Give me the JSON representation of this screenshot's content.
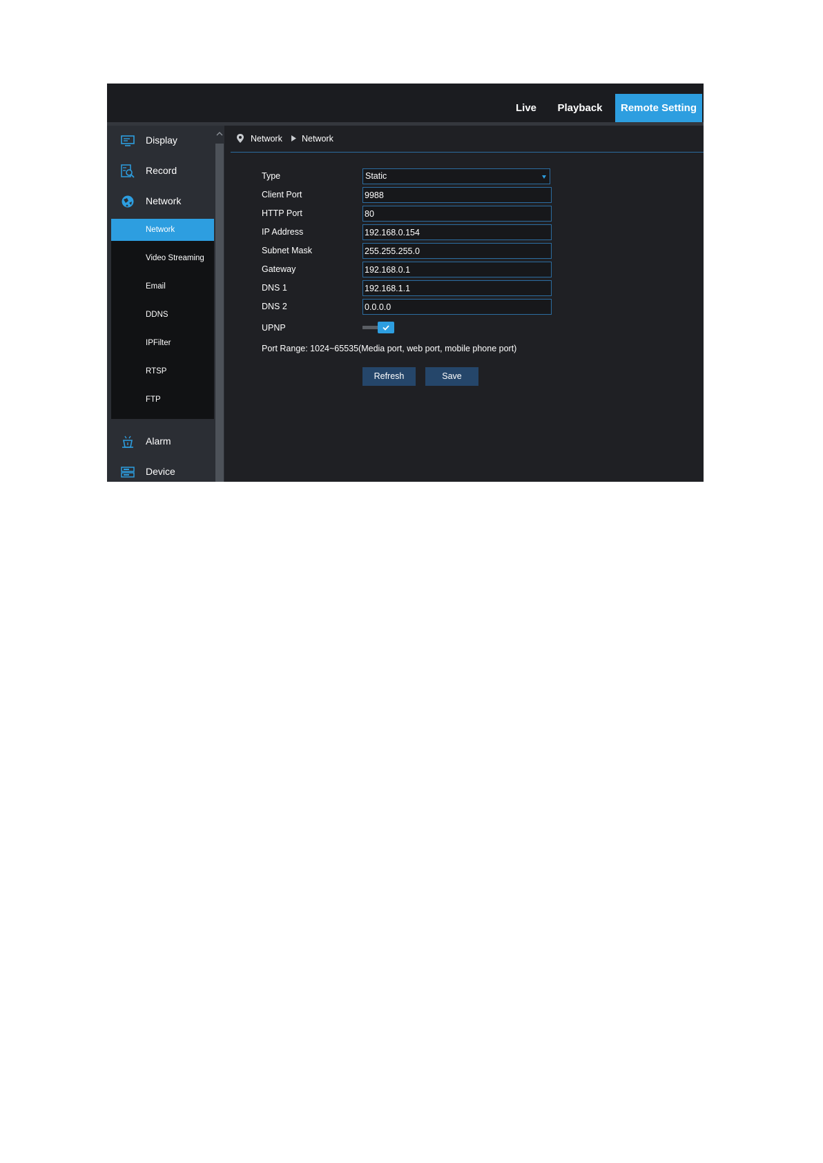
{
  "topbar": {
    "tabs": [
      "Live",
      "Playback",
      "Remote Setting"
    ],
    "active_tab": "Remote Setting"
  },
  "sidebar": {
    "items": [
      {
        "label": "Display",
        "icon": "monitor-icon"
      },
      {
        "label": "Record",
        "icon": "record-search-icon"
      },
      {
        "label": "Network",
        "icon": "network-globe-icon"
      },
      {
        "label": "Alarm",
        "icon": "alarm-icon"
      },
      {
        "label": "Device",
        "icon": "device-storage-icon"
      }
    ],
    "network_subitems": [
      "Network",
      "Video Streaming",
      "Email",
      "DDNS",
      "IPFilter",
      "RTSP",
      "FTP"
    ],
    "active_subitem": "Network"
  },
  "breadcrumb": {
    "level1": "Network",
    "level2": "Network"
  },
  "form": {
    "type": {
      "label": "Type",
      "value": "Static"
    },
    "client_port": {
      "label": "Client Port",
      "value": "9988"
    },
    "http_port": {
      "label": "HTTP Port",
      "value": "80"
    },
    "ip_address": {
      "label": "IP Address",
      "value": "192.168.0.154"
    },
    "subnet_mask": {
      "label": "Subnet Mask",
      "value": "255.255.255.0"
    },
    "gateway": {
      "label": "Gateway",
      "value": "192.168.0.1"
    },
    "dns1": {
      "label": "DNS 1",
      "value": "192.168.1.1"
    },
    "dns2": {
      "label": "DNS 2",
      "value": "0.0.0.0"
    },
    "upnp": {
      "label": "UPNP",
      "enabled": true
    },
    "port_range_note": "Port Range: 1024~65535(Media port, web port, mobile phone port)"
  },
  "buttons": {
    "refresh": "Refresh",
    "save": "Save"
  },
  "colors": {
    "accent": "#2d9ee0",
    "background": "#1f2024",
    "sidebar": "#2b2e34",
    "button": "#25466a"
  }
}
